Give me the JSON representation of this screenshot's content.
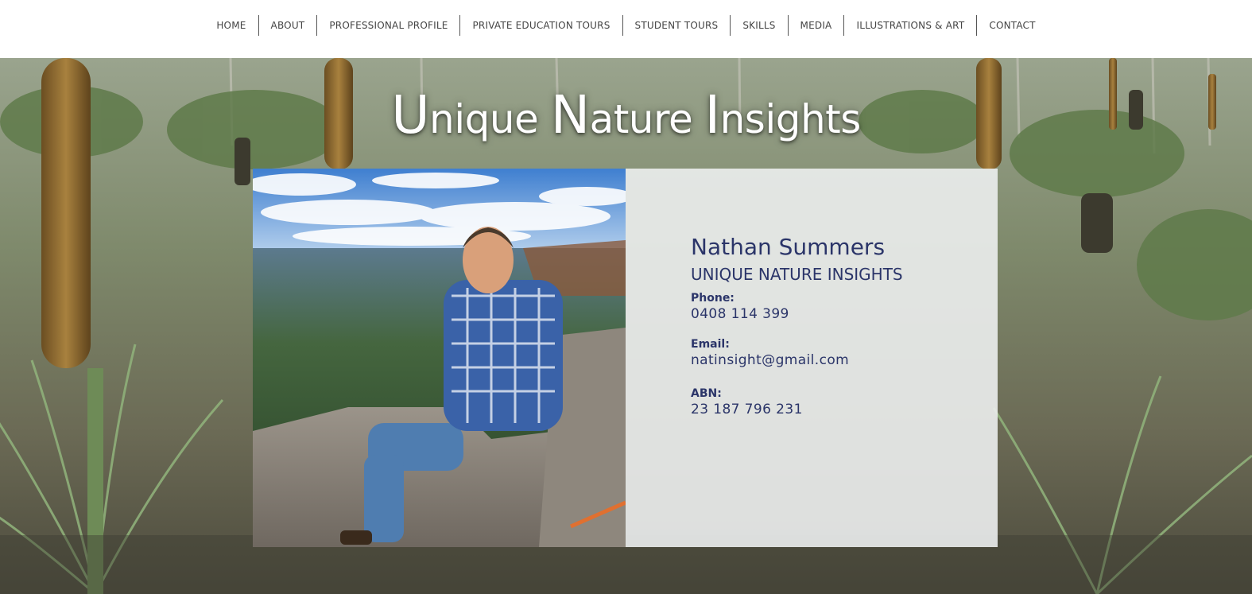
{
  "nav": {
    "items": [
      {
        "label": "HOME"
      },
      {
        "label": "ABOUT"
      },
      {
        "label": "PROFESSIONAL PROFILE"
      },
      {
        "label": "PRIVATE EDUCATION TOURS"
      },
      {
        "label": "STUDENT TOURS"
      },
      {
        "label": "SKILLS"
      },
      {
        "label": "MEDIA"
      },
      {
        "label": "ILLUSTRATIONS & ART"
      },
      {
        "label": "CONTACT"
      }
    ]
  },
  "hero": {
    "title_parts": [
      {
        "initial": "U",
        "rest": "nique "
      },
      {
        "initial": "N",
        "rest": "ature "
      },
      {
        "initial": "I",
        "rest": "nsights"
      }
    ]
  },
  "contact": {
    "name": "Nathan Summers",
    "company": "UNIQUE NATURE INSIGHTS",
    "phone_label": "Phone:",
    "phone": "0408 114 399",
    "email_label": "Email:",
    "email": "natinsight@gmail.com",
    "abn_label": "ABN:",
    "abn": "23 187 796 231"
  },
  "colors": {
    "text_navy": "#2b3569",
    "nav_text": "#444444",
    "card_bg": "#eceeee"
  }
}
